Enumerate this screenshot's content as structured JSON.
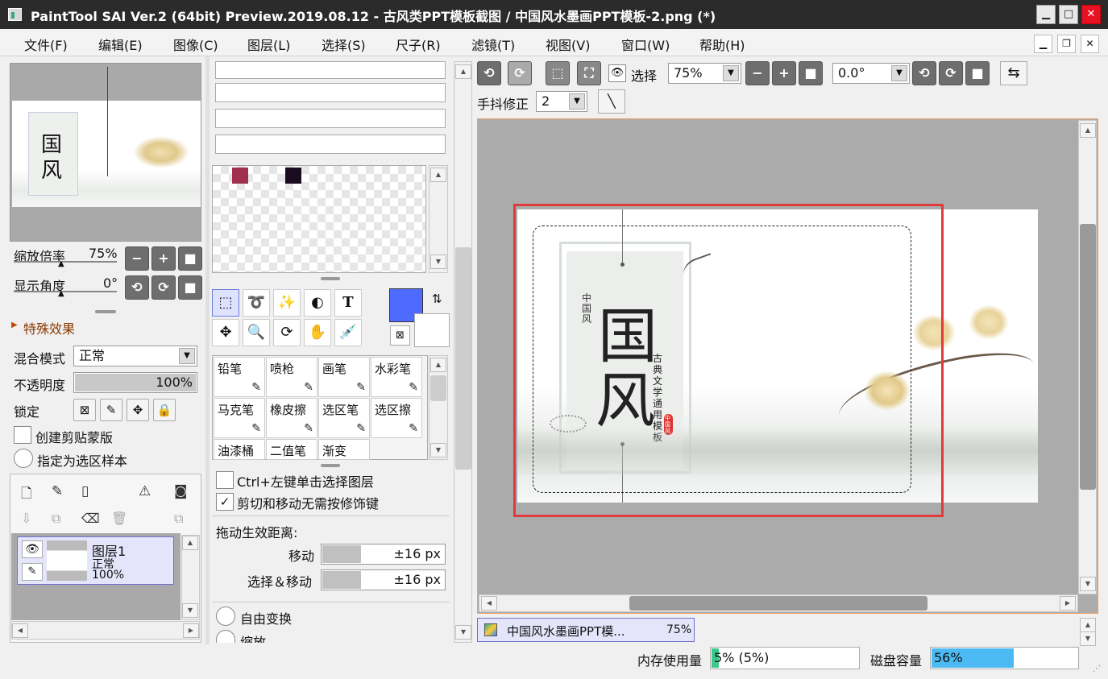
{
  "window": {
    "title": "PaintTool SAI Ver.2 (64bit) Preview.2019.08.12 - 古风类PPT模板截图 / 中国风水墨画PPT模板-2.png (*)",
    "min": "▁",
    "max": "□",
    "close": "✕"
  },
  "menu": [
    "文件(F)",
    "编辑(E)",
    "图像(C)",
    "图层(L)",
    "选择(S)",
    "尺子(R)",
    "滤镜(T)",
    "视图(V)",
    "窗口(W)",
    "帮助(H)"
  ],
  "navigator": {
    "zoom_label": "缩放倍率",
    "zoom_value": "75%",
    "angle_label": "显示角度",
    "angle_value": "0°"
  },
  "effects": {
    "label": "特殊效果"
  },
  "layer_props": {
    "blend_label": "混合模式",
    "blend_value": "正常",
    "opacity_label": "不透明度",
    "opacity_value": "100%",
    "opacity_fraction": 1.0,
    "lock_label": "锁定",
    "clip_label": "创建剪贴蒙版",
    "sample_label": "指定为选区样本"
  },
  "layer": {
    "name": "图层1",
    "mode": "正常",
    "opacity": "100%"
  },
  "swatches": [
    "#a0304f",
    "#1a0b1f"
  ],
  "colors": {
    "primary": "#4f6bff",
    "secondary": "#ffffff",
    "accent_red": "#e03a3a"
  },
  "brushes": [
    {
      "label": "铅笔",
      "icon": "pencil-icon"
    },
    {
      "label": "喷枪",
      "icon": "airbrush-icon"
    },
    {
      "label": "画笔",
      "icon": "brush-icon"
    },
    {
      "label": "水彩笔",
      "icon": "watercolor-icon"
    },
    {
      "label": "马克笔",
      "icon": "marker-icon"
    },
    {
      "label": "橡皮擦",
      "icon": "eraser-icon"
    },
    {
      "label": "选区笔",
      "icon": "selection-pen-icon"
    },
    {
      "label": "选区擦",
      "icon": "selection-eraser-icon"
    },
    {
      "label": "油漆桶",
      "icon": ""
    },
    {
      "label": "二值笔",
      "icon": ""
    },
    {
      "label": "渐变",
      "icon": ""
    }
  ],
  "tool_options": {
    "ctrl_label": "Ctrl+左键单击选择图层",
    "cut_label": "剪切和移动无需按修饰键",
    "drag_label": "拖动生效距离:",
    "move_label": "移动",
    "move_value": "±16 px",
    "selmove_label": "选择＆移动",
    "selmove_value": "±16 px",
    "free_transform": "自由变换",
    "scale": "缩放"
  },
  "canvas_toolbar": {
    "select_label": "选择",
    "zoom": "75%",
    "angle": "0.0°",
    "stabilizer_label": "手抖修正",
    "stabilizer_value": "2"
  },
  "artwork": {
    "small_title": "中国风",
    "big1": "国",
    "big2": "风",
    "subtitle": "古典文学通用模板",
    "stamp": "中国风"
  },
  "tab": {
    "name": "中国风水墨画PPT模...",
    "zoom": "75%"
  },
  "status": {
    "mem_label": "内存使用量",
    "mem_value": "5% (5%)",
    "mem_fraction": 0.05,
    "disk_label": "磁盘容量",
    "disk_value": "56%",
    "disk_fraction": 0.56
  }
}
